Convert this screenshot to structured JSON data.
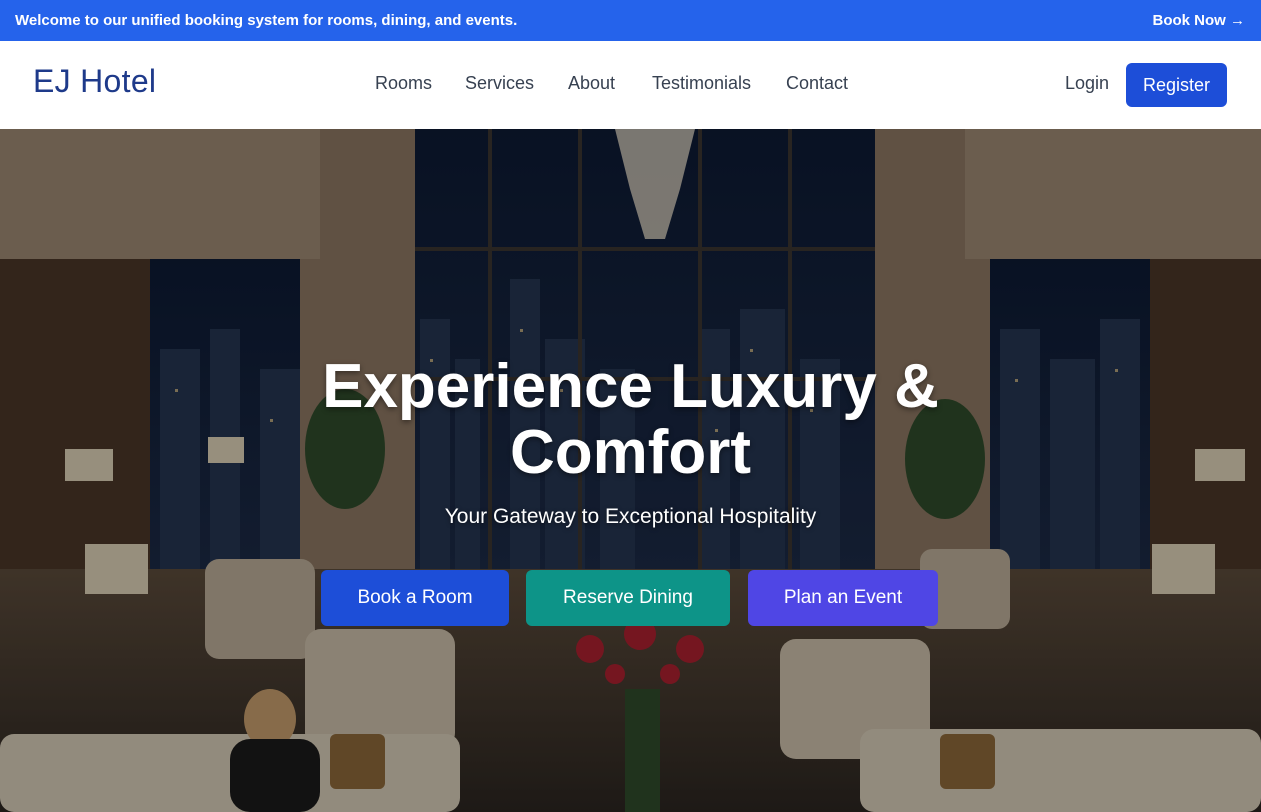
{
  "announcement": {
    "text": "Welcome to our unified booking system for rooms, dining, and events.",
    "link_label": "Book Now →"
  },
  "nav": {
    "brand": "EJ Hotel",
    "links": [
      "Rooms",
      "Services",
      "About",
      "Testimonials",
      "Contact"
    ],
    "login_label": "Login",
    "register_label": "Register"
  },
  "hero": {
    "title_line1": "Experience Luxury &",
    "title_line2": "Comfort",
    "subtitle": "Your Gateway to Exceptional Hospitality",
    "buttons": {
      "book_room": "Book a Room",
      "reserve_dining": "Reserve Dining",
      "plan_event": "Plan an Event"
    }
  },
  "colors": {
    "announcement_bg": "#2563eb",
    "brand": "#1e3a8a",
    "register_bg": "#1d4ed8",
    "book_room_bg": "#1d4ed8",
    "reserve_dining_bg": "#0d9488",
    "plan_event_bg": "#4f46e5"
  }
}
